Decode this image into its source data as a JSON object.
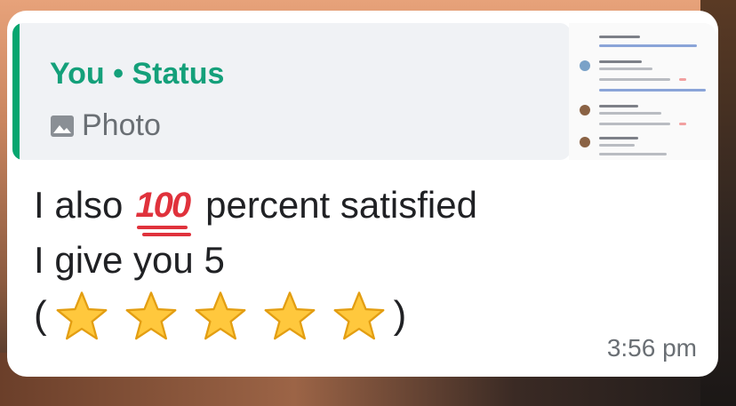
{
  "quote": {
    "author": "You • Status",
    "type_label": "Photo",
    "accent_color": "#06a66f",
    "author_color": "#14a07a",
    "icon": "photo-icon"
  },
  "message": {
    "line1_before": "I also",
    "line1_emoji": "100",
    "line1_after": "percent satisfied",
    "line2": "I give you 5",
    "open_paren": "(",
    "close_paren": ")",
    "star_count": 5,
    "star_icon": "star-icon"
  },
  "timestamp": "3:56 pm"
}
